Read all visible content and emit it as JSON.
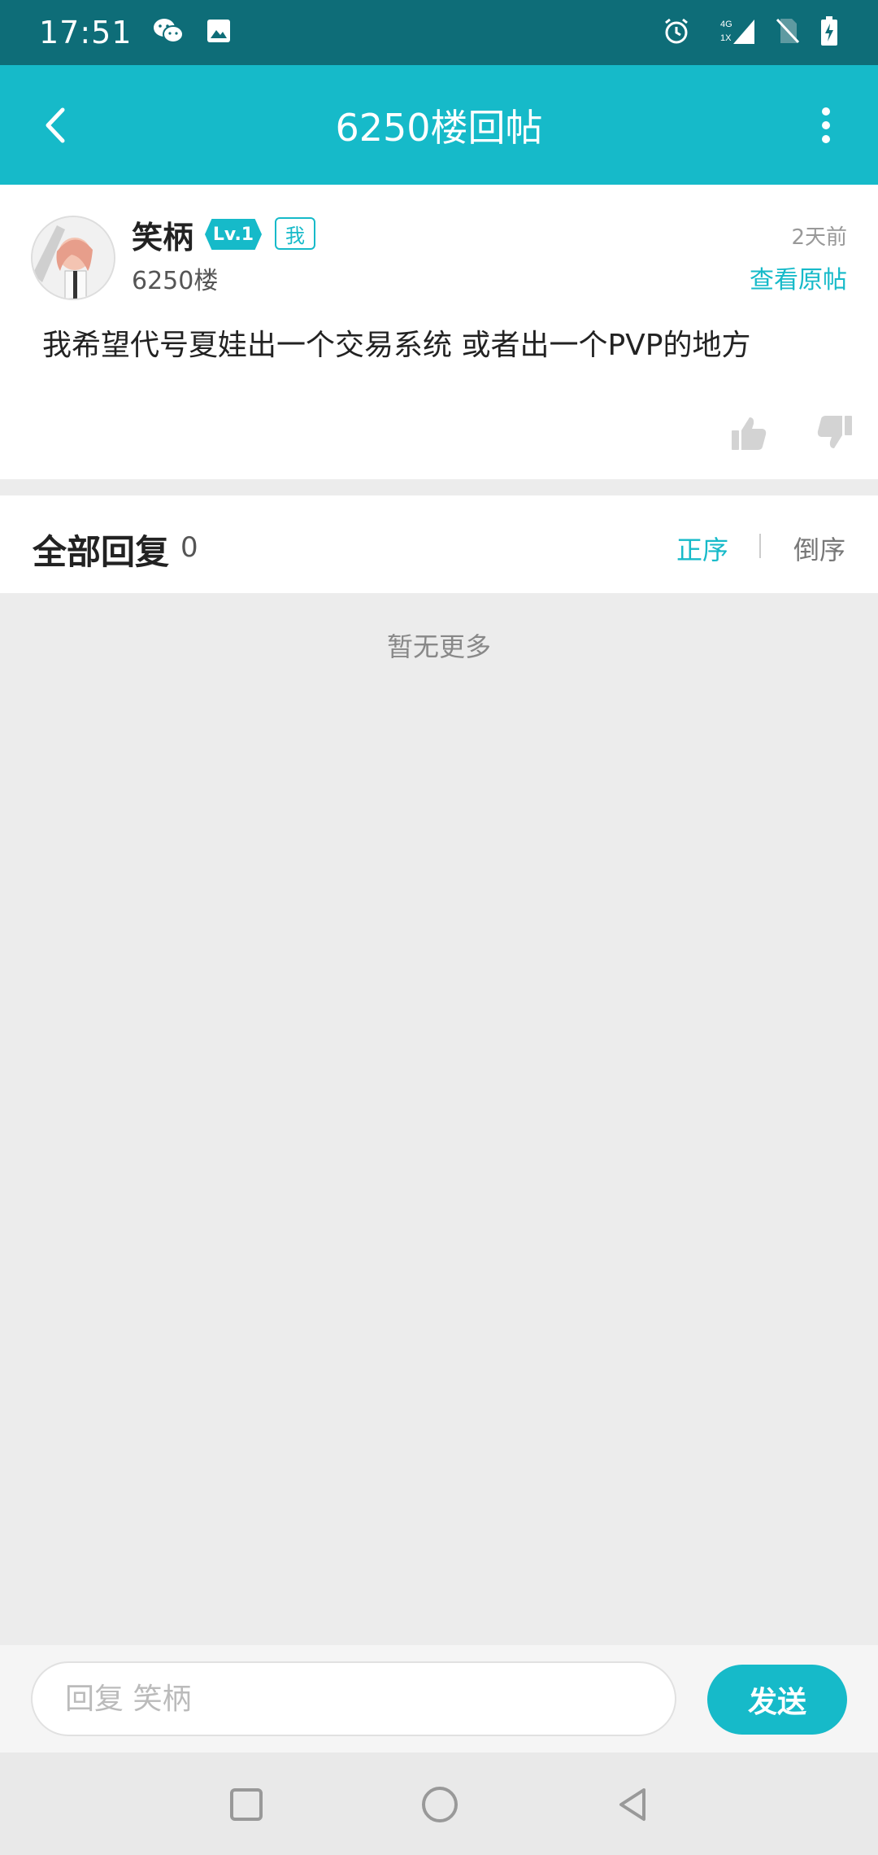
{
  "status_bar": {
    "time": "17:51",
    "icons": [
      "wechat-icon",
      "gallery-icon",
      "alarm-icon",
      "signal-4g-icon",
      "no-sim-icon",
      "battery-charging-icon"
    ],
    "network_top": "4G",
    "network_bottom": "1X"
  },
  "header": {
    "title": "6250楼回帖",
    "back_icon": "chevron-left-icon",
    "more_icon": "more-vertical-icon"
  },
  "post": {
    "username": "笑柄",
    "level_badge": "Lv.1",
    "me_badge": "我",
    "floor": "6250楼",
    "time": "2天前",
    "view_original": "查看原帖",
    "content": "我希望代号夏娃出一个交易系统 或者出一个PVP的地方",
    "like_icon": "thumbs-up-icon",
    "dislike_icon": "thumbs-down-icon"
  },
  "replies": {
    "title": "全部回复",
    "count": "0",
    "sort_asc": "正序",
    "sort_desc": "倒序",
    "empty_text": "暂无更多"
  },
  "reply_bar": {
    "placeholder": "回复 笑柄",
    "send_label": "发送"
  },
  "colors": {
    "accent": "#16bac9",
    "status_bar": "#0e6d78",
    "background": "#ececec"
  }
}
